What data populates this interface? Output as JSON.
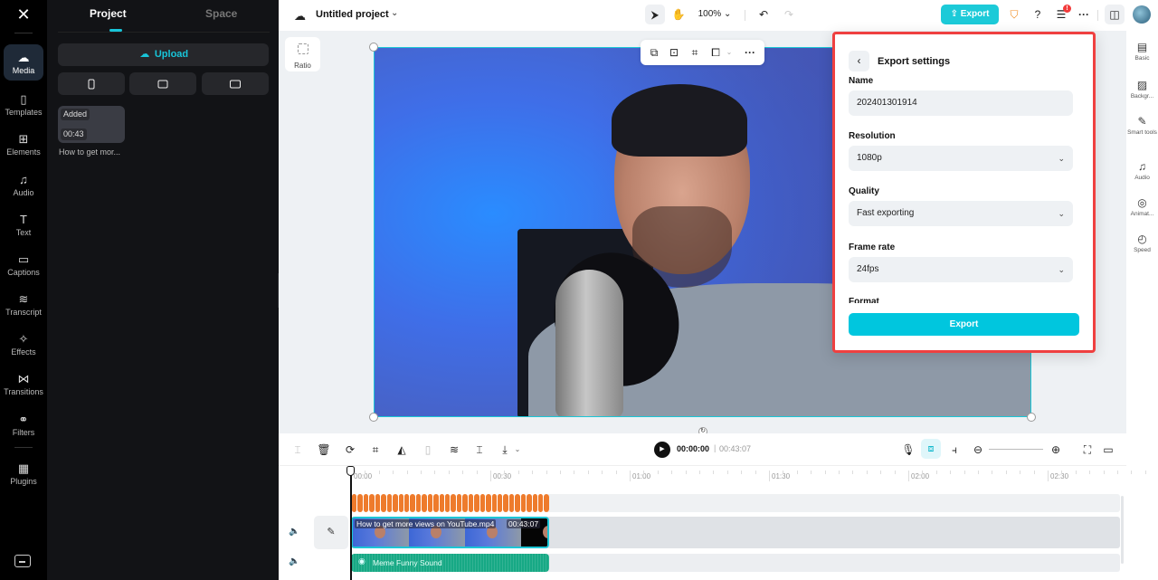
{
  "rail": {
    "logo_icon": "capcut-logo-icon",
    "items": [
      {
        "label": "Media",
        "icon": "cloud-upload-icon",
        "glyph": "☁",
        "active": true
      },
      {
        "label": "Templates",
        "icon": "templates-icon",
        "glyph": "▯"
      },
      {
        "label": "Elements",
        "icon": "elements-icon",
        "glyph": "⊞"
      },
      {
        "label": "Audio",
        "icon": "music-note-icon",
        "glyph": "♫"
      },
      {
        "label": "Text",
        "icon": "text-icon",
        "glyph": "T"
      },
      {
        "label": "Captions",
        "icon": "captions-icon",
        "glyph": "▭"
      },
      {
        "label": "Transcript",
        "icon": "transcript-icon",
        "glyph": "≋"
      },
      {
        "label": "Effects",
        "icon": "effects-star-icon",
        "glyph": "✧"
      },
      {
        "label": "Transitions",
        "icon": "transitions-icon",
        "glyph": "⋈"
      },
      {
        "label": "Filters",
        "icon": "filters-icon",
        "glyph": "⚭"
      },
      {
        "label": "Plugins",
        "icon": "plugins-grid-icon",
        "glyph": "▦"
      }
    ],
    "keyboard_icon": "keyboard-shortcuts-icon"
  },
  "panel": {
    "tabs": [
      "Project",
      "Space"
    ],
    "active_tab": "Project",
    "upload_label": "Upload",
    "source_buttons": [
      "phone-icon",
      "camera-icon",
      "screen-record-icon"
    ],
    "media": [
      {
        "badge": "Added",
        "duration": "00:43",
        "name": "How to get mor..."
      }
    ]
  },
  "topbar": {
    "project_title": "Untitled project",
    "zoom_level": "100%",
    "export_label": "Export",
    "notification_count": "!"
  },
  "stage": {
    "ratio_label": "Ratio"
  },
  "export_settings": {
    "title": "Export settings",
    "fields": [
      {
        "label": "Name",
        "value": "202401301914",
        "dropdown": false
      },
      {
        "label": "Resolution",
        "value": "1080p",
        "dropdown": true
      },
      {
        "label": "Quality",
        "value": "Fast exporting",
        "dropdown": true
      },
      {
        "label": "Frame rate",
        "value": "24fps",
        "dropdown": true
      }
    ],
    "format_label": "Format",
    "export_button": "Export",
    "highlight_color": "#ef4040"
  },
  "properties": [
    {
      "label": "Basic",
      "icon": "film-icon",
      "glyph": "▤"
    },
    {
      "label": "Backgr...",
      "icon": "background-icon",
      "glyph": "▨"
    },
    {
      "label": "Smart tools",
      "icon": "magic-wand-icon",
      "glyph": "✎"
    },
    {
      "label": "Audio",
      "icon": "music-note-icon",
      "glyph": "♫"
    },
    {
      "label": "Animat...",
      "icon": "animation-icon",
      "glyph": "◎"
    },
    {
      "label": "Speed",
      "icon": "speed-gauge-icon",
      "glyph": "◴"
    }
  ],
  "timeline": {
    "current_time": "00:00:00",
    "total_time": "00:43:07",
    "ruler": [
      "00:00",
      "00:30",
      "01:00",
      "01:30",
      "02:00",
      "02:30"
    ],
    "video_clip": {
      "name": "How to get more views on YouTube.mp4",
      "duration": "00:43:07"
    },
    "audio_clip": {
      "name": "Meme Funny Sound"
    },
    "accent_color": "#1cc6d6",
    "sticker_color": "#ee7b2c",
    "audio_color": "#17a985"
  }
}
